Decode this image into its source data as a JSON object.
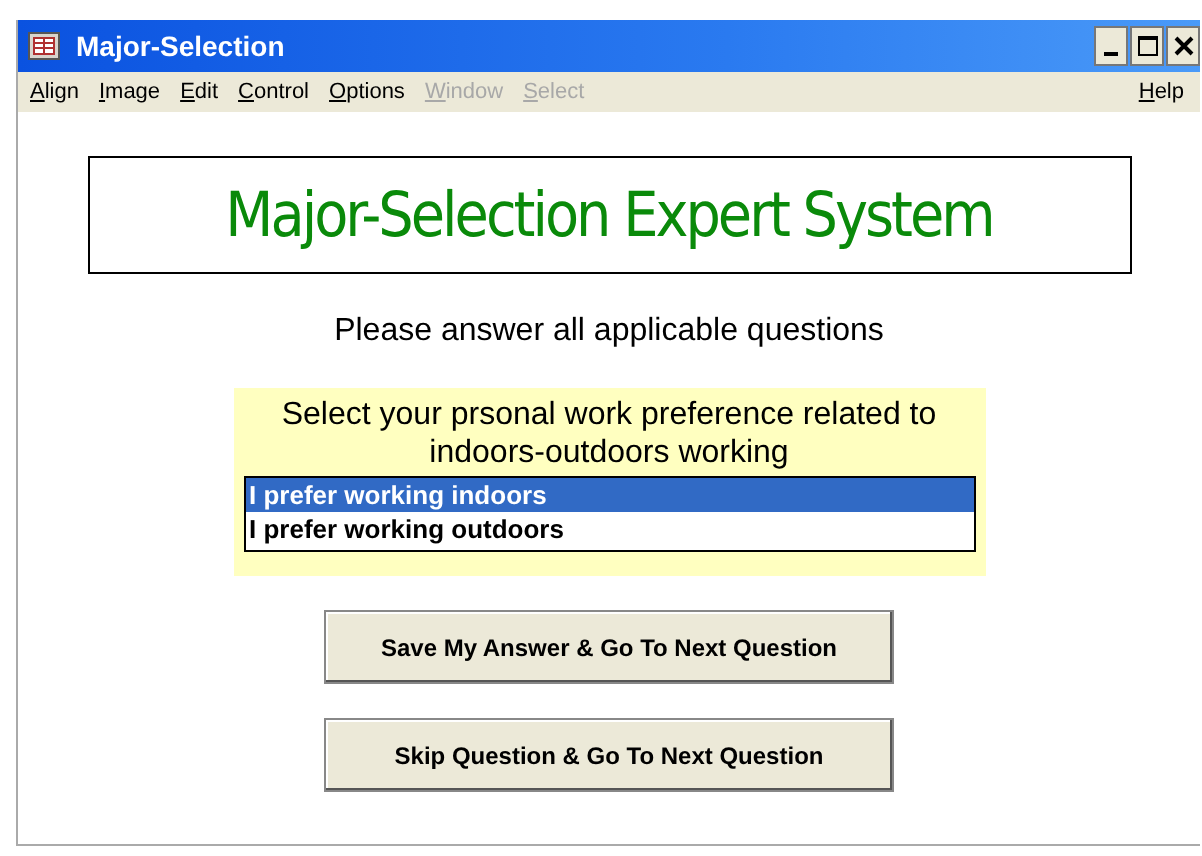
{
  "window": {
    "title": "Major-Selection"
  },
  "menu": [
    {
      "label": "Align",
      "disabled": false
    },
    {
      "label": "Image",
      "disabled": false
    },
    {
      "label": "Edit",
      "disabled": false
    },
    {
      "label": "Control",
      "disabled": false
    },
    {
      "label": "Options",
      "disabled": false
    },
    {
      "label": "Window",
      "disabled": true
    },
    {
      "label": "Select",
      "disabled": true
    }
  ],
  "help_menu": {
    "label": "Help",
    "disabled": false
  },
  "banner": "Major-Selection Expert System",
  "instruction": "Please answer all applicable questions",
  "question": {
    "prompt": "Select your prsonal work preference related to indoors-outdoors working",
    "options": [
      {
        "label": "I prefer working indoors",
        "selected": true
      },
      {
        "label": "I prefer working outdoors",
        "selected": false
      }
    ]
  },
  "buttons": [
    "Save My Answer & Go To Next Question",
    "Skip Question & Go To Next Question"
  ]
}
